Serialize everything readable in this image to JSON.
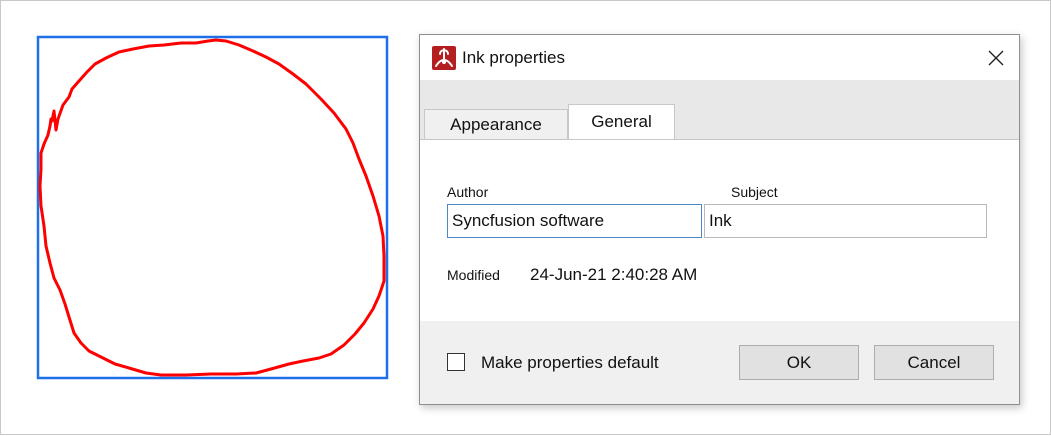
{
  "dialog": {
    "title": "Ink properties",
    "tabs": [
      {
        "label": "Appearance",
        "selected": false
      },
      {
        "label": "General",
        "selected": true
      }
    ],
    "general": {
      "author_label": "Author",
      "author_value": "Syncfusion software",
      "subject_label": "Subject",
      "subject_value": "Ink",
      "modified_label": "Modified",
      "modified_value": "24-Jun-21 2:40:28 AM"
    },
    "footer": {
      "checkbox_label": "Make properties default",
      "checkbox_checked": false,
      "ok_label": "OK",
      "cancel_label": "Cancel"
    }
  },
  "annotation": {
    "type": "ink",
    "stroke_color": "#ff0000",
    "selection_color": "#1e6fe8"
  },
  "icons": {
    "app": "pdf-app-icon",
    "close": "close-icon"
  }
}
